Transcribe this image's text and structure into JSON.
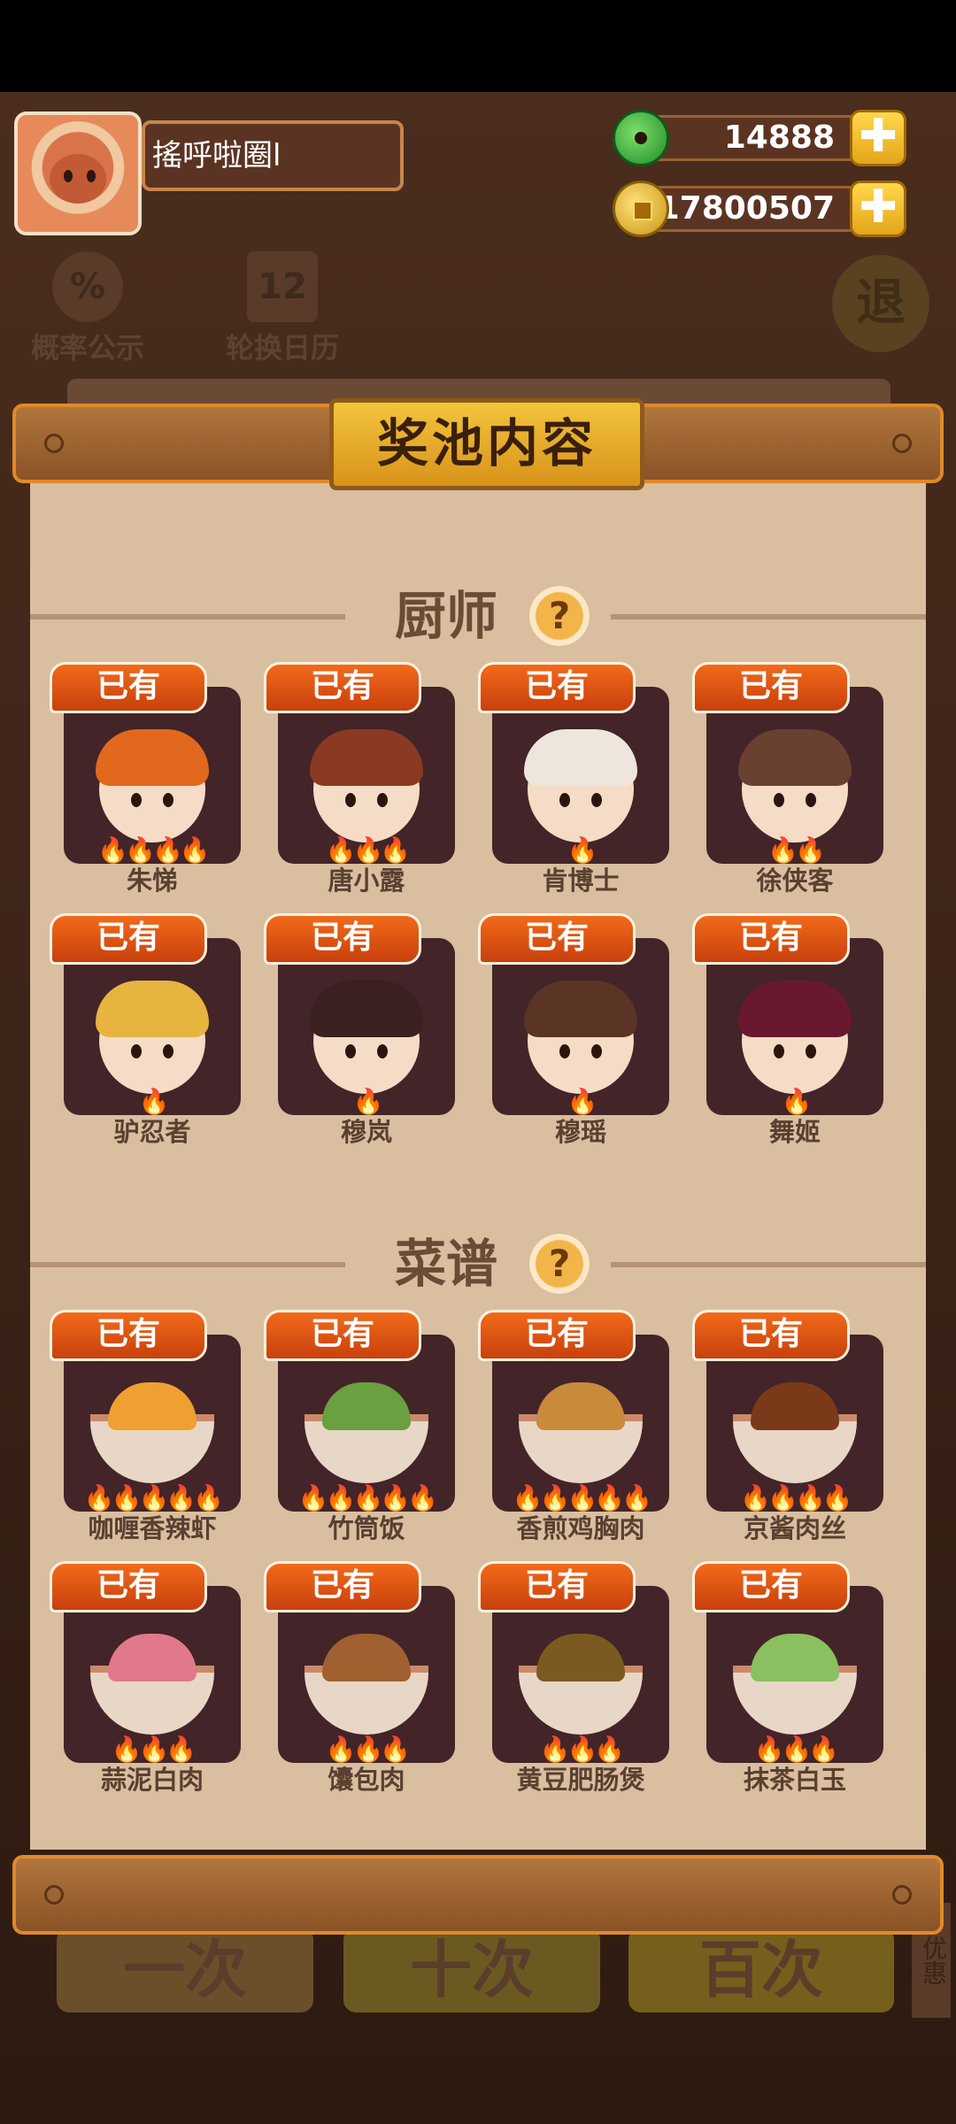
{
  "player": {
    "name": "搖呼啦圈l"
  },
  "currency": {
    "jade": "14888",
    "gold": "17800507",
    "plus": "✚"
  },
  "background": {
    "prob_label": "概率公示",
    "prob_icon": "%",
    "calendar_label": "轮换日历",
    "calendar_icon": "12",
    "exit_label": "退",
    "draw_one": "一次",
    "draw_ten": "十次",
    "draw_hundred": "百次",
    "side_tab": "优惠"
  },
  "dialog": {
    "title": "奖池内容",
    "help_glyph": "?",
    "sections": [
      {
        "label": "厨师",
        "items": [
          {
            "badge": "已有",
            "name": "朱悌",
            "stars": 4
          },
          {
            "badge": "已有",
            "name": "唐小露",
            "stars": 3
          },
          {
            "badge": "已有",
            "name": "肯博士",
            "stars": 1
          },
          {
            "badge": "已有",
            "name": "徐侠客",
            "stars": 2
          },
          {
            "badge": "已有",
            "name": "驴忍者",
            "stars": 1
          },
          {
            "badge": "已有",
            "name": "穆岚",
            "stars": 1
          },
          {
            "badge": "已有",
            "name": "穆瑶",
            "stars": 1
          },
          {
            "badge": "已有",
            "name": "舞姬",
            "stars": 1
          }
        ]
      },
      {
        "label": "菜谱",
        "items": [
          {
            "badge": "已有",
            "name": "咖喱香辣虾",
            "stars": 5
          },
          {
            "badge": "已有",
            "name": "竹筒饭",
            "stars": 5
          },
          {
            "badge": "已有",
            "name": "香煎鸡胸肉",
            "stars": 5
          },
          {
            "badge": "已有",
            "name": "京酱肉丝",
            "stars": 4
          },
          {
            "badge": "已有",
            "name": "蒜泥白肉",
            "stars": 3
          },
          {
            "badge": "已有",
            "name": "馕包肉",
            "stars": 3
          },
          {
            "badge": "已有",
            "name": "黄豆肥肠煲",
            "stars": 3
          },
          {
            "badge": "已有",
            "name": "抹茶白玉",
            "stars": 3
          }
        ]
      }
    ]
  },
  "colors": {
    "badge": "#e0541a",
    "frame": "#432428",
    "panel": "#d9bea0",
    "accent": "#f3c43d"
  },
  "icons": {
    "jade": "jade-coin-icon",
    "gold": "gold-coin-icon",
    "help": "question-icon",
    "star": "flame-icon"
  }
}
